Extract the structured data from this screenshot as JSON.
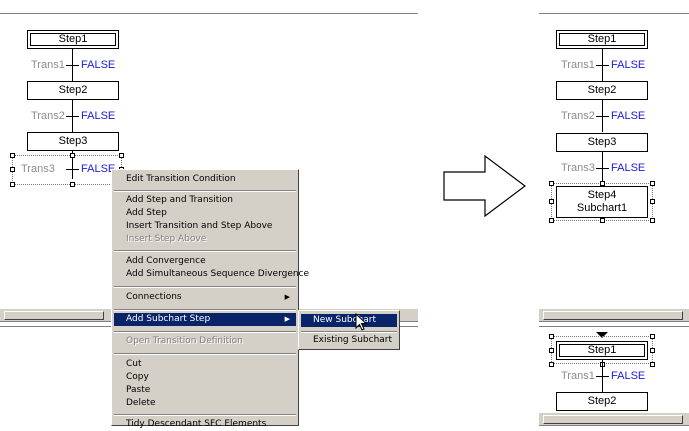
{
  "left_chart": {
    "steps": [
      "Step1",
      "Step2",
      "Step3"
    ],
    "transitions": [
      {
        "name": "Trans1",
        "condition": "FALSE"
      },
      {
        "name": "Trans2",
        "condition": "FALSE"
      },
      {
        "name": "Trans3",
        "condition": "FALSE"
      }
    ]
  },
  "context_menu": {
    "items": [
      {
        "label": "Edit Transition Condition",
        "disabled": false
      },
      {
        "label": "Add Step and Transition",
        "disabled": false
      },
      {
        "label": "Add Step",
        "disabled": false
      },
      {
        "label": "Insert Transition and Step Above",
        "disabled": false
      },
      {
        "label": "Insert Step Above",
        "disabled": true
      },
      {
        "label": "Add Convergence",
        "disabled": false
      },
      {
        "label": "Add Simultaneous Sequence Divergence",
        "disabled": false
      },
      {
        "label": "Connections",
        "disabled": false
      },
      {
        "label": "Add Subchart Step",
        "disabled": false
      },
      {
        "label": "Open Transition Definition",
        "disabled": true
      },
      {
        "label": "Cut",
        "disabled": false
      },
      {
        "label": "Copy",
        "disabled": false
      },
      {
        "label": "Paste",
        "disabled": false
      },
      {
        "label": "Delete",
        "disabled": false
      },
      {
        "label": "Tidy Descendant SFC Elements",
        "disabled": false
      }
    ]
  },
  "submenu": {
    "items": [
      "New Subchart",
      "Existing Subchart"
    ]
  },
  "right_chart": {
    "steps": [
      "Step1",
      "Step2",
      "Step3"
    ],
    "transitions": [
      {
        "name": "Trans1",
        "condition": "FALSE"
      },
      {
        "name": "Trans2",
        "condition": "FALSE"
      },
      {
        "name": "Trans3",
        "condition": "FALSE"
      }
    ],
    "subchart_step": {
      "name": "Step4",
      "subchart": "Subchart1"
    }
  },
  "subchart_view": {
    "steps": [
      "Step1",
      "Step2"
    ],
    "transitions": [
      {
        "name": "Trans1",
        "condition": "FALSE"
      }
    ]
  }
}
